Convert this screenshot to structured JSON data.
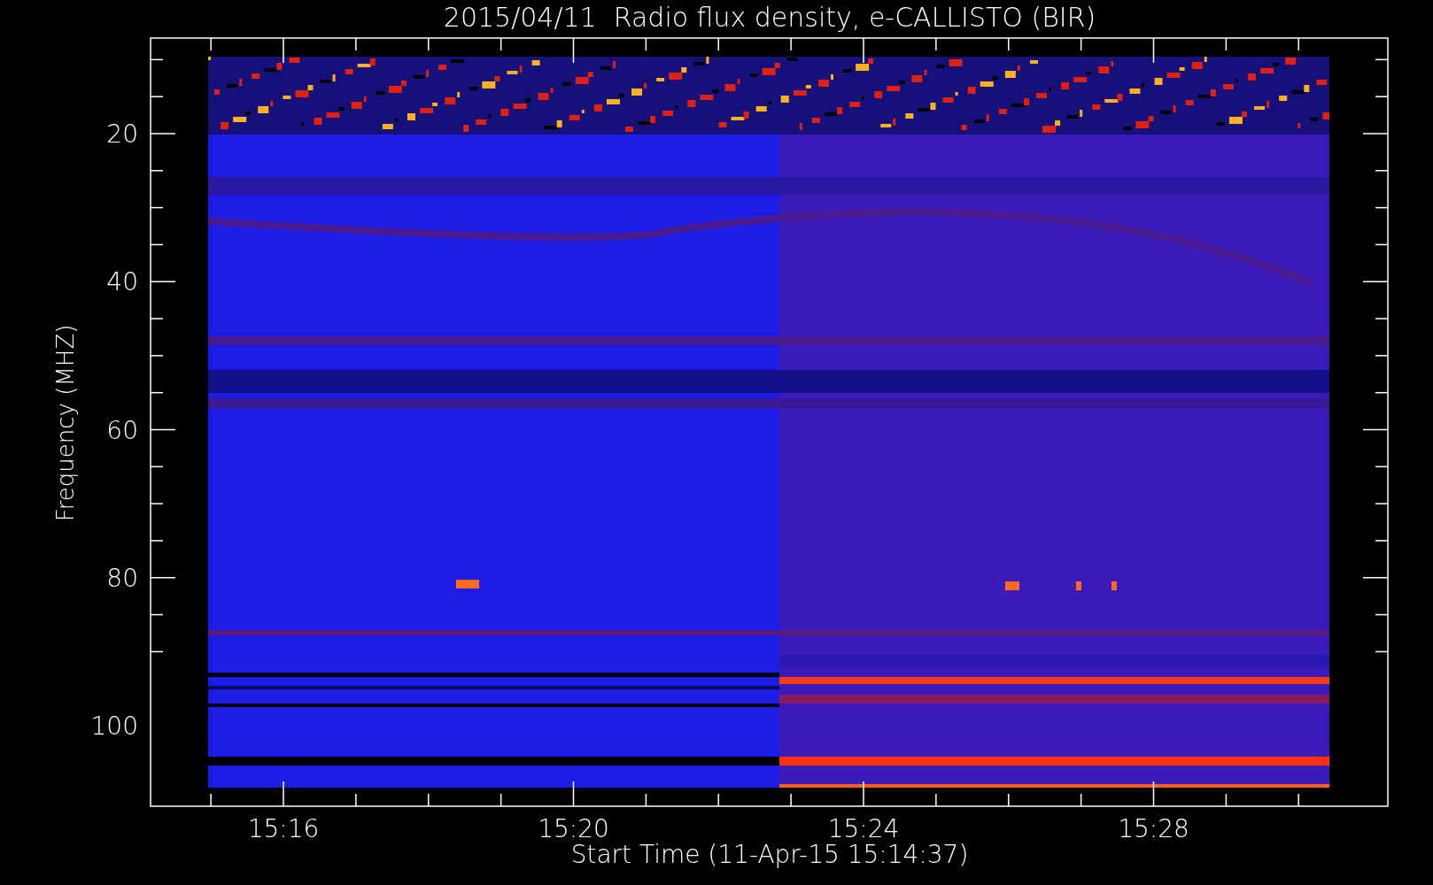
{
  "title": "2015/04/11  Radio flux density, e-CALLISTO (BIR)",
  "y_axis": {
    "label": "Frequency (MHZ)",
    "ticks": [
      "20",
      "40",
      "60",
      "80",
      "100"
    ]
  },
  "x_axis": {
    "label": "Start Time (11-Apr-15 15:14:37)",
    "ticks": [
      "15:16",
      "15:20",
      "15:24",
      "15:28"
    ]
  }
}
